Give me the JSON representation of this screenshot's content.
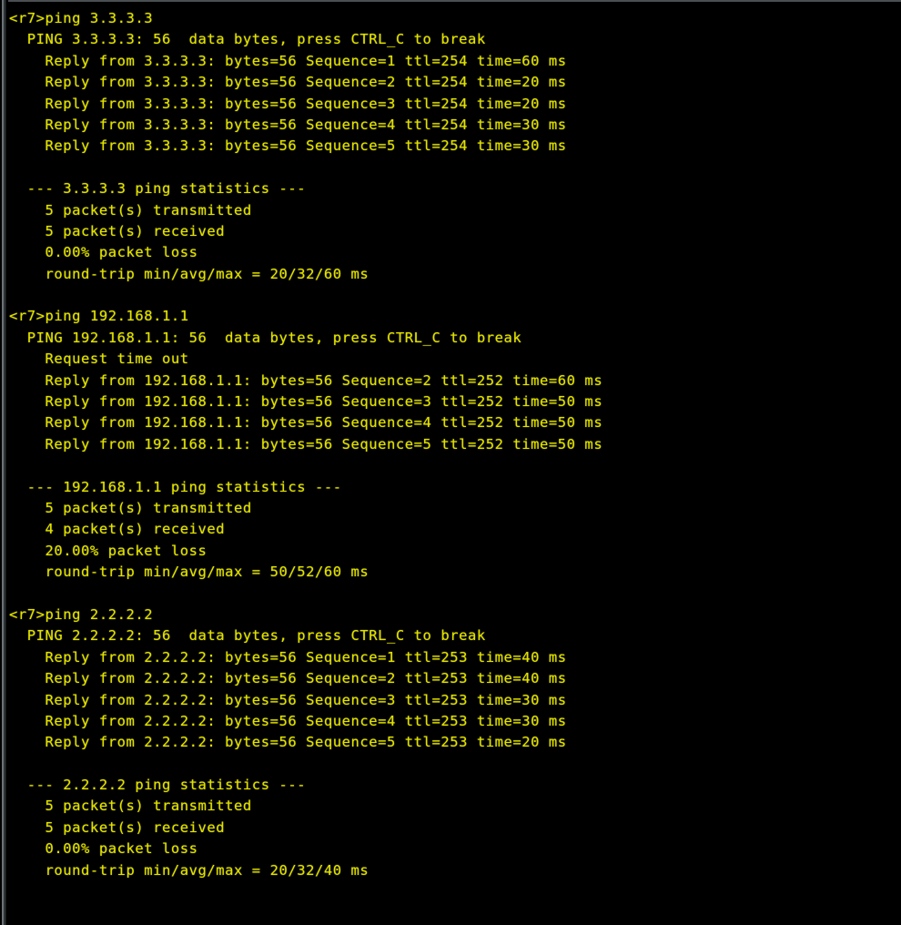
{
  "terminal": {
    "prompt": "<r7>",
    "foreground_color": "#e2e200",
    "background_color": "#000000",
    "scrollbar_color": "#6c7276",
    "lines": [
      "<r7>ping 3.3.3.3",
      "  PING 3.3.3.3: 56  data bytes, press CTRL_C to break",
      "    Reply from 3.3.3.3: bytes=56 Sequence=1 ttl=254 time=60 ms",
      "    Reply from 3.3.3.3: bytes=56 Sequence=2 ttl=254 time=20 ms",
      "    Reply from 3.3.3.3: bytes=56 Sequence=3 ttl=254 time=20 ms",
      "    Reply from 3.3.3.3: bytes=56 Sequence=4 ttl=254 time=30 ms",
      "    Reply from 3.3.3.3: bytes=56 Sequence=5 ttl=254 time=30 ms",
      "",
      "  --- 3.3.3.3 ping statistics ---",
      "    5 packet(s) transmitted",
      "    5 packet(s) received",
      "    0.00% packet loss",
      "    round-trip min/avg/max = 20/32/60 ms",
      "",
      "<r7>ping 192.168.1.1",
      "  PING 192.168.1.1: 56  data bytes, press CTRL_C to break",
      "    Request time out",
      "    Reply from 192.168.1.1: bytes=56 Sequence=2 ttl=252 time=60 ms",
      "    Reply from 192.168.1.1: bytes=56 Sequence=3 ttl=252 time=50 ms",
      "    Reply from 192.168.1.1: bytes=56 Sequence=4 ttl=252 time=50 ms",
      "    Reply from 192.168.1.1: bytes=56 Sequence=5 ttl=252 time=50 ms",
      "",
      "  --- 192.168.1.1 ping statistics ---",
      "    5 packet(s) transmitted",
      "    4 packet(s) received",
      "    20.00% packet loss",
      "    round-trip min/avg/max = 50/52/60 ms",
      "",
      "<r7>ping 2.2.2.2",
      "  PING 2.2.2.2: 56  data bytes, press CTRL_C to break",
      "    Reply from 2.2.2.2: bytes=56 Sequence=1 ttl=253 time=40 ms",
      "    Reply from 2.2.2.2: bytes=56 Sequence=2 ttl=253 time=40 ms",
      "    Reply from 2.2.2.2: bytes=56 Sequence=3 ttl=253 time=30 ms",
      "    Reply from 2.2.2.2: bytes=56 Sequence=4 ttl=253 time=30 ms",
      "    Reply from 2.2.2.2: bytes=56 Sequence=5 ttl=253 time=20 ms",
      "",
      "  --- 2.2.2.2 ping statistics ---",
      "    5 packet(s) transmitted",
      "    5 packet(s) received",
      "    0.00% packet loss",
      "    round-trip min/avg/max = 20/32/40 ms"
    ]
  },
  "ping_sessions": [
    {
      "command": "ping 3.3.3.3",
      "target": "3.3.3.3",
      "header": "PING 3.3.3.3: 56  data bytes, press CTRL_C to break",
      "data_bytes": "56",
      "replies": [
        {
          "from": "3.3.3.3",
          "bytes": "56",
          "sequence": "1",
          "ttl": "254",
          "time": "60 ms"
        },
        {
          "from": "3.3.3.3",
          "bytes": "56",
          "sequence": "2",
          "ttl": "254",
          "time": "20 ms"
        },
        {
          "from": "3.3.3.3",
          "bytes": "56",
          "sequence": "3",
          "ttl": "254",
          "time": "20 ms"
        },
        {
          "from": "3.3.3.3",
          "bytes": "56",
          "sequence": "4",
          "ttl": "254",
          "time": "30 ms"
        },
        {
          "from": "3.3.3.3",
          "bytes": "56",
          "sequence": "5",
          "ttl": "254",
          "time": "30 ms"
        }
      ],
      "statistics_title": "--- 3.3.3.3 ping statistics ---",
      "transmitted": "5 packet(s) transmitted",
      "received": "5 packet(s) received",
      "loss": "0.00% packet loss",
      "round_trip": "round-trip min/avg/max = 20/32/60 ms"
    },
    {
      "command": "ping 192.168.1.1",
      "target": "192.168.1.1",
      "header": "PING 192.168.1.1: 56  data bytes, press CTRL_C to break",
      "data_bytes": "56",
      "timeout": "Request time out",
      "replies": [
        {
          "from": "192.168.1.1",
          "bytes": "56",
          "sequence": "2",
          "ttl": "252",
          "time": "60 ms"
        },
        {
          "from": "192.168.1.1",
          "bytes": "56",
          "sequence": "3",
          "ttl": "252",
          "time": "50 ms"
        },
        {
          "from": "192.168.1.1",
          "bytes": "56",
          "sequence": "4",
          "ttl": "252",
          "time": "50 ms"
        },
        {
          "from": "192.168.1.1",
          "bytes": "56",
          "sequence": "5",
          "ttl": "252",
          "time": "50 ms"
        }
      ],
      "statistics_title": "--- 192.168.1.1 ping statistics ---",
      "transmitted": "5 packet(s) transmitted",
      "received": "4 packet(s) received",
      "loss": "20.00% packet loss",
      "round_trip": "round-trip min/avg/max = 50/52/60 ms"
    },
    {
      "command": "ping 2.2.2.2",
      "target": "2.2.2.2",
      "header": "PING 2.2.2.2: 56  data bytes, press CTRL_C to break",
      "data_bytes": "56",
      "replies": [
        {
          "from": "2.2.2.2",
          "bytes": "56",
          "sequence": "1",
          "ttl": "253",
          "time": "40 ms"
        },
        {
          "from": "2.2.2.2",
          "bytes": "56",
          "sequence": "2",
          "ttl": "253",
          "time": "40 ms"
        },
        {
          "from": "2.2.2.2",
          "bytes": "56",
          "sequence": "3",
          "ttl": "253",
          "time": "30 ms"
        },
        {
          "from": "2.2.2.2",
          "bytes": "56",
          "sequence": "4",
          "ttl": "253",
          "time": "30 ms"
        },
        {
          "from": "2.2.2.2",
          "bytes": "56",
          "sequence": "5",
          "ttl": "253",
          "time": "20 ms"
        }
      ],
      "statistics_title": "--- 2.2.2.2 ping statistics ---",
      "transmitted": "5 packet(s) transmitted",
      "received": "5 packet(s) received",
      "loss": "0.00% packet loss",
      "round_trip": "round-trip min/avg/max = 20/32/40 ms"
    }
  ]
}
